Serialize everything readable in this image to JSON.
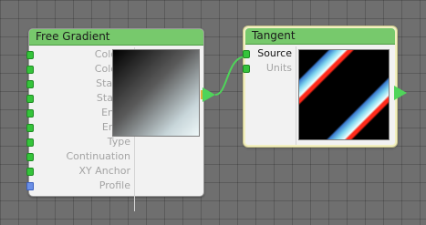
{
  "nodes": {
    "free_gradient": {
      "title": "Free Gradient",
      "ports": [
        {
          "label": "Color 1"
        },
        {
          "label": "Color 2"
        },
        {
          "label": "Start X"
        },
        {
          "label": "Start Y"
        },
        {
          "label": "End X"
        },
        {
          "label": "End Y"
        },
        {
          "label": "Type"
        },
        {
          "label": "Continuation"
        },
        {
          "label": "XY Anchor"
        },
        {
          "label": "Profile"
        }
      ]
    },
    "tangent": {
      "title": "Tangent",
      "ports": [
        {
          "label": "Source"
        },
        {
          "label": "Units"
        }
      ]
    }
  },
  "colors": {
    "title_bar": "#77c96c",
    "port_connector": "#35c43b",
    "profile_connector": "#6b8fe6",
    "wire": "#4fd45a",
    "selection_border": "#f3f0c0"
  }
}
